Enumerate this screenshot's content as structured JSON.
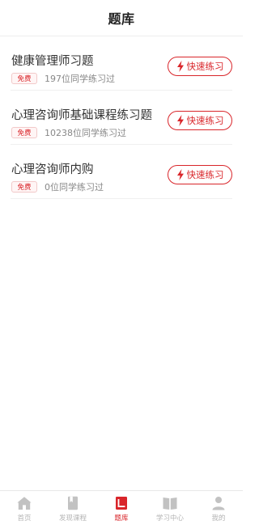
{
  "header": {
    "title": "题库"
  },
  "colors": {
    "accent": "#d9252a",
    "tab_inactive": "#c2c2c2"
  },
  "banks": [
    {
      "title": "健康管理师习题",
      "badge": "免费",
      "count_text": "197位同学练习过",
      "button_label": "快速练习",
      "button_icon": "lightning-icon"
    },
    {
      "title": "心理咨询师基础课程练习题",
      "badge": "免费",
      "count_text": "10238位同学练习过",
      "button_label": "快速练习",
      "button_icon": "lightning-icon"
    },
    {
      "title": "心理咨询师内购",
      "badge": "免费",
      "count_text": "0位同学练习过",
      "button_label": "快速练习",
      "button_icon": "lightning-icon"
    }
  ],
  "tabbar": {
    "tabs": [
      {
        "label": "首页",
        "icon": "home-icon",
        "active": false
      },
      {
        "label": "发现课程",
        "icon": "book-icon",
        "active": false
      },
      {
        "label": "题库",
        "icon": "question-bank-icon",
        "active": true
      },
      {
        "label": "学习中心",
        "icon": "open-book-icon",
        "active": false
      },
      {
        "label": "我的",
        "icon": "person-icon",
        "active": false
      }
    ]
  }
}
